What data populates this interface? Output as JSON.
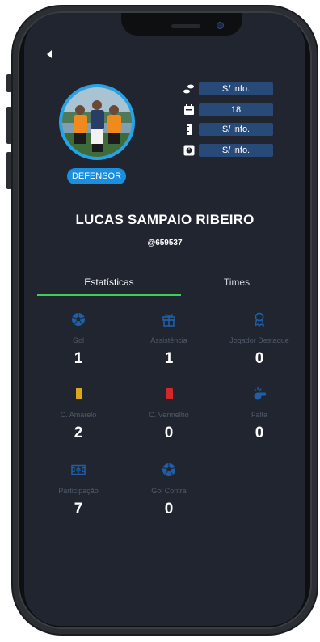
{
  "profile": {
    "name": "LUCAS SAMPAIO RIBEIRO",
    "handle": "@659537",
    "position": "DEFENSOR"
  },
  "info": [
    {
      "icon": "footprints-icon",
      "value": "S/ info."
    },
    {
      "icon": "calendar-icon",
      "value": "18"
    },
    {
      "icon": "height-ruler-icon",
      "value": "S/ info."
    },
    {
      "icon": "scale-icon",
      "value": "S/ info."
    }
  ],
  "tabs": [
    {
      "label": "Estatísticas",
      "active": true
    },
    {
      "label": "Times",
      "active": false
    }
  ],
  "stats": [
    {
      "icon": "soccer-ball-icon",
      "label": "Gol",
      "value": "1"
    },
    {
      "icon": "gift-icon",
      "label": "Assistência",
      "value": "1"
    },
    {
      "icon": "award-medal-icon",
      "label": "Jogador Destaque",
      "value": "0"
    },
    {
      "icon": "yellow-card-icon",
      "label": "C. Amarelo",
      "value": "2"
    },
    {
      "icon": "red-card-icon",
      "label": "C. Vermelho",
      "value": "0"
    },
    {
      "icon": "whistle-icon",
      "label": "Falta",
      "value": "0"
    },
    {
      "icon": "soccer-field-icon",
      "label": "Participação",
      "value": "7"
    },
    {
      "icon": "soccer-ball-icon",
      "label": "Gol Contra",
      "value": "0"
    }
  ],
  "colors": {
    "screen_bg": "#202530",
    "accent_blue": "#1a8fe0",
    "pill_bg": "#284a78",
    "tab_active": "#3ecf5a",
    "icon_blue": "#1e5fa8",
    "yellow_card": "#d9a81b",
    "red_card": "#d32828"
  }
}
